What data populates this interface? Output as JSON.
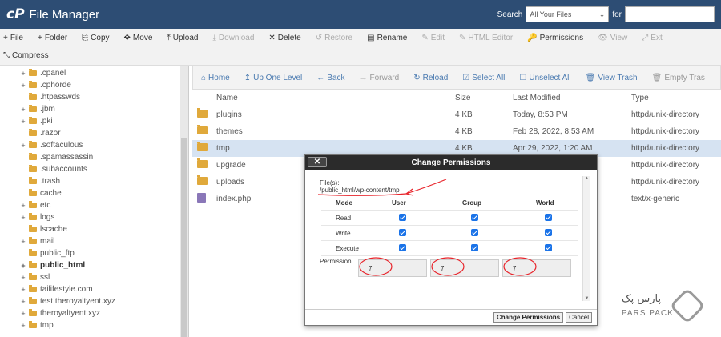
{
  "header": {
    "logo_mark": "cP",
    "title": "File Manager",
    "search_label": "Search",
    "search_scope": "All Your Files",
    "search_for": "for",
    "search_value": ""
  },
  "toolbar": {
    "row1": [
      {
        "icon": "+",
        "label": "File",
        "disabled": false
      },
      {
        "icon": "+",
        "label": "Folder",
        "disabled": false
      },
      {
        "icon": "⎘",
        "label": "Copy",
        "disabled": false
      },
      {
        "icon": "✥",
        "label": "Move",
        "disabled": false
      },
      {
        "icon": "⤒",
        "label": "Upload",
        "disabled": false
      },
      {
        "icon": "⤓",
        "label": "Download",
        "disabled": true
      },
      {
        "icon": "✕",
        "label": "Delete",
        "disabled": false
      },
      {
        "icon": "↺",
        "label": "Restore",
        "disabled": true
      },
      {
        "icon": "▤",
        "label": "Rename",
        "disabled": false
      },
      {
        "icon": "✎",
        "label": "Edit",
        "disabled": true
      },
      {
        "icon": "✎",
        "label": "HTML Editor",
        "disabled": true
      },
      {
        "icon": "🔑",
        "label": "Permissions",
        "disabled": false
      },
      {
        "icon": "👁",
        "label": "View",
        "disabled": true
      },
      {
        "icon": "⤢",
        "label": "Ext",
        "disabled": true
      }
    ],
    "row2": [
      {
        "icon": "⤡",
        "label": "Compress",
        "disabled": false
      }
    ]
  },
  "sidebar": {
    "items": [
      {
        "expand": "+",
        "label": ".cpanel",
        "bold": false,
        "indent": 24
      },
      {
        "expand": "+",
        "label": ".cphorde",
        "bold": false,
        "indent": 24
      },
      {
        "expand": "",
        "label": ".htpasswds",
        "bold": false,
        "indent": 34
      },
      {
        "expand": "+",
        "label": ".jbm",
        "bold": false,
        "indent": 24
      },
      {
        "expand": "+",
        "label": ".pki",
        "bold": false,
        "indent": 24
      },
      {
        "expand": "",
        "label": ".razor",
        "bold": false,
        "indent": 34
      },
      {
        "expand": "+",
        "label": ".softaculous",
        "bold": false,
        "indent": 24
      },
      {
        "expand": "",
        "label": ".spamassassin",
        "bold": false,
        "indent": 34
      },
      {
        "expand": "",
        "label": ".subaccounts",
        "bold": false,
        "indent": 34
      },
      {
        "expand": "",
        "label": ".trash",
        "bold": false,
        "indent": 34
      },
      {
        "expand": "",
        "label": "cache",
        "bold": false,
        "indent": 34
      },
      {
        "expand": "+",
        "label": "etc",
        "bold": false,
        "indent": 24
      },
      {
        "expand": "+",
        "label": "logs",
        "bold": false,
        "indent": 24
      },
      {
        "expand": "",
        "label": "lscache",
        "bold": false,
        "indent": 34
      },
      {
        "expand": "+",
        "label": "mail",
        "bold": false,
        "indent": 24
      },
      {
        "expand": "",
        "label": "public_ftp",
        "bold": false,
        "indent": 34
      },
      {
        "expand": "+",
        "label": "public_html",
        "bold": true,
        "indent": 24
      },
      {
        "expand": "+",
        "label": "ssl",
        "bold": false,
        "indent": 24
      },
      {
        "expand": "+",
        "label": "tailifestyle.com",
        "bold": false,
        "indent": 24
      },
      {
        "expand": "+",
        "label": "test.theroyaltyent.xyz",
        "bold": false,
        "indent": 24
      },
      {
        "expand": "+",
        "label": "theroyaltyent.xyz",
        "bold": false,
        "indent": 24
      },
      {
        "expand": "+",
        "label": "tmp",
        "bold": false,
        "indent": 24
      }
    ]
  },
  "nav": [
    {
      "icon": "⌂",
      "label": "Home",
      "disabled": false
    },
    {
      "icon": "↥",
      "label": "Up One Level",
      "disabled": false
    },
    {
      "icon": "←",
      "label": "Back",
      "disabled": false
    },
    {
      "icon": "→",
      "label": "Forward",
      "disabled": true
    },
    {
      "icon": "↻",
      "label": "Reload",
      "disabled": false
    },
    {
      "icon": "☑",
      "label": "Select All",
      "disabled": false
    },
    {
      "icon": "☐",
      "label": "Unselect All",
      "disabled": false
    },
    {
      "icon": "🗑",
      "label": "View Trash",
      "disabled": false
    },
    {
      "icon": "🗑",
      "label": "Empty Tras",
      "disabled": true
    }
  ],
  "table": {
    "headers": {
      "name": "Name",
      "size": "Size",
      "modified": "Last Modified",
      "type": "Type"
    },
    "rows": [
      {
        "kind": "folder",
        "name": "plugins",
        "size": "4 KB",
        "modified": "Today, 8:53 PM",
        "type": "httpd/unix-directory",
        "selected": false
      },
      {
        "kind": "folder",
        "name": "themes",
        "size": "4 KB",
        "modified": "Feb 28, 2022, 8:53 AM",
        "type": "httpd/unix-directory",
        "selected": false
      },
      {
        "kind": "folder",
        "name": "tmp",
        "size": "4 KB",
        "modified": "Apr 29, 2022, 1:20 AM",
        "type": "httpd/unix-directory",
        "selected": true
      },
      {
        "kind": "folder",
        "name": "upgrade",
        "size": "",
        "modified": "",
        "type": "httpd/unix-directory",
        "selected": false
      },
      {
        "kind": "folder",
        "name": "uploads",
        "size": "",
        "modified": "",
        "type": "httpd/unix-directory",
        "selected": false
      },
      {
        "kind": "file",
        "name": "index.php",
        "size": "",
        "modified": "",
        "type": "text/x-generic",
        "selected": false
      }
    ]
  },
  "dialog": {
    "title": "Change Permissions",
    "close_label": "✕",
    "file_label": "File(s):",
    "file_path": "/public_html/wp-content/tmp",
    "headers": {
      "mode": "Mode",
      "user": "User",
      "group": "Group",
      "world": "World"
    },
    "modes": [
      "Read",
      "Write",
      "Execute"
    ],
    "permission_label": "Permission",
    "permission_values": [
      "7",
      "7",
      "7"
    ],
    "submit_label": "Change Permissions",
    "cancel_label": "Cancel"
  },
  "watermark": {
    "fa": "پارس پک",
    "en": "PARS PACK"
  },
  "colors": {
    "header": "#2d4d74",
    "link": "#4a7ab0",
    "selected_row": "#d6e3f2",
    "annotation": "#e8232a"
  }
}
